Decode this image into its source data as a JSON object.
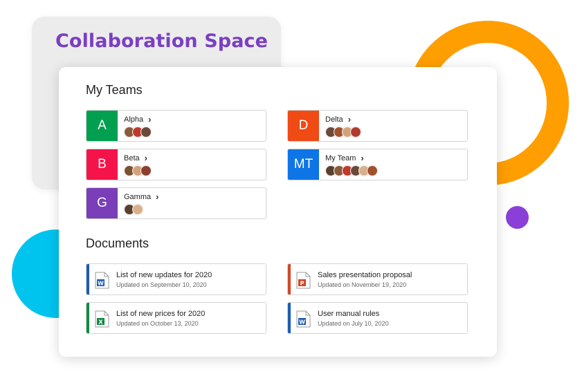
{
  "title": "Collaboration Space",
  "teams_section": {
    "heading": "My Teams",
    "teams": [
      {
        "initial": "A",
        "name": "Alpha",
        "color": "#00a050",
        "avatars": [
          "#8a5a3c",
          "#c0392b",
          "#6b4a3a"
        ]
      },
      {
        "initial": "B",
        "name": "Beta",
        "color": "#f5144a",
        "avatars": [
          "#7a5230",
          "#d4a27a",
          "#8a4030"
        ]
      },
      {
        "initial": "G",
        "name": "Gamma",
        "color": "#7a3fb8",
        "avatars": [
          "#5b4030",
          "#d9b08c"
        ]
      },
      {
        "initial": "D",
        "name": "Delta",
        "color": "#f04a15",
        "avatars": [
          "#6b4a3a",
          "#a0522d",
          "#d4a27a",
          "#b03a2e"
        ]
      },
      {
        "initial": "MT",
        "name": "My Team",
        "color": "#0e75e6",
        "avatars": [
          "#5b4030",
          "#8a5a3c",
          "#c0392b",
          "#6b4a3a",
          "#d9b08c",
          "#a0522d"
        ]
      }
    ]
  },
  "documents_section": {
    "heading": "Documents",
    "documents": [
      {
        "title": "List of new updates for 2020",
        "updated": "Updated on September 10, 2020",
        "type": "word",
        "icon": "word-doc-icon",
        "accent": "#1e5cb3",
        "letter": "W"
      },
      {
        "title": "List of new prices for 2020",
        "updated": "Updated on October 13, 2020",
        "type": "excel",
        "icon": "excel-doc-icon",
        "accent": "#138a43",
        "letter": "X"
      },
      {
        "title": "Sales presentation proposal",
        "updated": "Updated on November 19, 2020",
        "type": "powerpoint",
        "icon": "powerpoint-doc-icon",
        "accent": "#d24726",
        "letter": "P"
      },
      {
        "title": "User manual rules",
        "updated": "Updated on July 10, 2020",
        "type": "word",
        "icon": "word-doc-icon",
        "accent": "#1e5cb3",
        "letter": "W"
      }
    ]
  },
  "colors": {
    "ring": "#ff9e00",
    "dot": "#8a3fd8",
    "circle": "#00c4ee",
    "title": "#7a3fc2"
  }
}
